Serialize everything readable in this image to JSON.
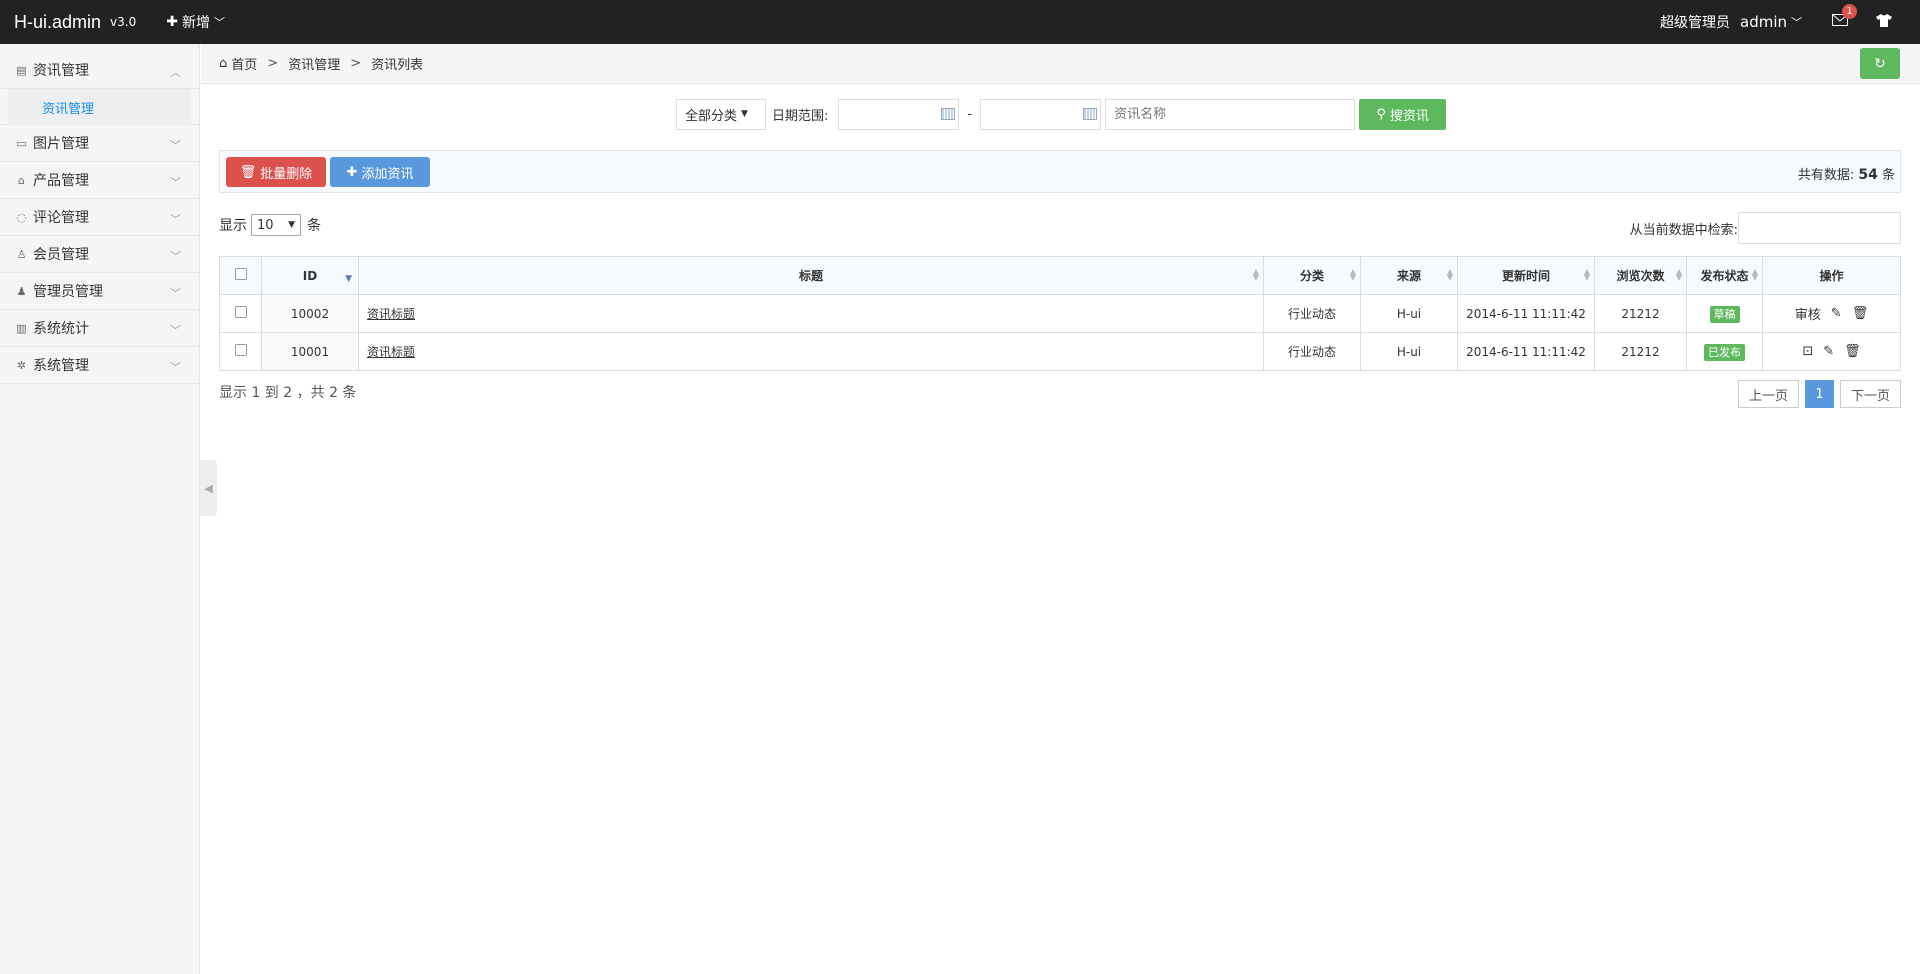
{
  "topbar": {
    "brand": "H-ui.admin",
    "version": "v3.0",
    "new_label": "新增",
    "role": "超级管理员",
    "user": "admin",
    "mail_count": "1"
  },
  "sidebar": {
    "items": [
      {
        "label": "资讯管理",
        "icon": "news-icon",
        "expanded": true,
        "sub": [
          "资讯管理"
        ]
      },
      {
        "label": "图片管理",
        "icon": "picture-icon"
      },
      {
        "label": "产品管理",
        "icon": "bag-icon"
      },
      {
        "label": "评论管理",
        "icon": "comment-icon"
      },
      {
        "label": "会员管理",
        "icon": "user-icon"
      },
      {
        "label": "管理员管理",
        "icon": "admin-icon"
      },
      {
        "label": "系统统计",
        "icon": "stats-icon"
      },
      {
        "label": "系统管理",
        "icon": "gear-icon"
      }
    ]
  },
  "breadcrumb": {
    "home": "首页",
    "sep": ">",
    "level1": "资讯管理",
    "level2": "资讯列表"
  },
  "search": {
    "category": "全部分类",
    "date_label": "日期范围:",
    "date_sep": "-",
    "name_placeholder": "资讯名称",
    "button": "搜资讯"
  },
  "actions": {
    "batch_delete": "批量删除",
    "add": "添加资讯",
    "total_prefix": "共有数据:",
    "total_count": "54",
    "total_suffix": "条"
  },
  "length": {
    "prefix": "显示",
    "value": "10",
    "suffix": "条"
  },
  "filter": {
    "label": "从当前数据中检索:"
  },
  "table": {
    "columns": [
      "ID",
      "标题",
      "分类",
      "来源",
      "更新时间",
      "浏览次数",
      "发布状态",
      "操作"
    ],
    "rows": [
      {
        "id": "10002",
        "title": "资讯标题",
        "category": "行业动态",
        "source": "H-ui",
        "time": "2014-6-11 11:11:42",
        "views": "21212",
        "status": "草稿",
        "op_text": "审核"
      },
      {
        "id": "10001",
        "title": "资讯标题",
        "category": "行业动态",
        "source": "H-ui",
        "time": "2014-6-11 11:11:42",
        "views": "21212",
        "status": "已发布",
        "op_text": ""
      }
    ]
  },
  "info": "显示 1 到 2 ，共 2 条",
  "pager": {
    "prev": "上一页",
    "current": "1",
    "next": "下一页"
  },
  "colors": {
    "green": "#5eb95e",
    "red": "#dd514c",
    "blue": "#5a98de",
    "topbar": "#222222"
  }
}
